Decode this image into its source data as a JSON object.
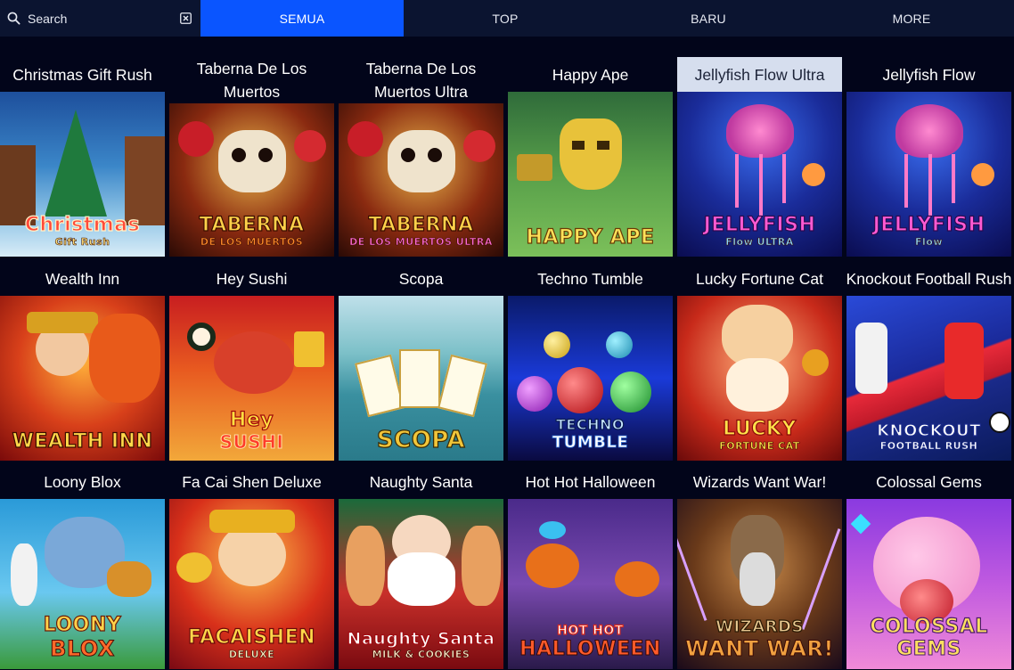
{
  "search": {
    "placeholder": "Search"
  },
  "tabs": [
    {
      "label": "SEMUA",
      "active": true
    },
    {
      "label": "TOP",
      "active": false
    },
    {
      "label": "BARU",
      "active": false
    },
    {
      "label": "MORE",
      "active": false
    }
  ],
  "colors": {
    "accent": "#0a55ff",
    "topbar": "#0b1430",
    "page_bg": "#02051a",
    "hover_title_bg": "#d6deee"
  },
  "games": [
    {
      "title": "Christmas Gift Rush",
      "logo": "Christmas",
      "logo_sub": "Gift Rush"
    },
    {
      "title": "Taberna De Los Muertos",
      "logo": "TABERNA",
      "logo_sub": "DE LOS MUERTOS"
    },
    {
      "title": "Taberna De Los Muertos Ultra",
      "logo": "TABERNA",
      "logo_sub": "DE LOS MUERTOS ULTRA"
    },
    {
      "title": "Happy Ape",
      "logo": "HAPPY APE",
      "logo_sub": ""
    },
    {
      "title": "Jellyfish Flow Ultra",
      "logo": "JELLYFISH",
      "logo_sub": "Flow ULTRA"
    },
    {
      "title": "Jellyfish Flow",
      "logo": "JELLYFISH",
      "logo_sub": "Flow"
    },
    {
      "title": "Wealth Inn",
      "logo": "WEALTH INN",
      "logo_sub": ""
    },
    {
      "title": "Hey Sushi",
      "logo": "Hey",
      "logo_sub": "SUSHI"
    },
    {
      "title": "Scopa",
      "logo": "SCOPA",
      "logo_sub": ""
    },
    {
      "title": "Techno Tumble",
      "logo": "TECHNO",
      "logo_sub": "TUMBLE"
    },
    {
      "title": "Lucky Fortune Cat",
      "logo": "LUCKY",
      "logo_sub": "FORTUNE CAT"
    },
    {
      "title": "Knockout Football Rush",
      "logo": "KNOCKOUT",
      "logo_sub": "FOOTBALL RUSH"
    },
    {
      "title": "Loony Blox",
      "logo": "LOONY",
      "logo_sub": "BLOX"
    },
    {
      "title": "Fa Cai Shen Deluxe",
      "logo": "FACAISHEN",
      "logo_sub": "DELUXE"
    },
    {
      "title": "Naughty Santa",
      "logo": "Naughty Santa",
      "logo_sub": "MILK & COOKIES"
    },
    {
      "title": "Hot Hot Halloween",
      "logo": "HOT HOT",
      "logo_sub": "HALLOWEEN"
    },
    {
      "title": "Wizards Want War!",
      "logo": "WIZARDS",
      "logo_sub": "WANT WAR!"
    },
    {
      "title": "Colossal Gems",
      "logo": "COLOSSAL",
      "logo_sub": "GEMS"
    }
  ]
}
